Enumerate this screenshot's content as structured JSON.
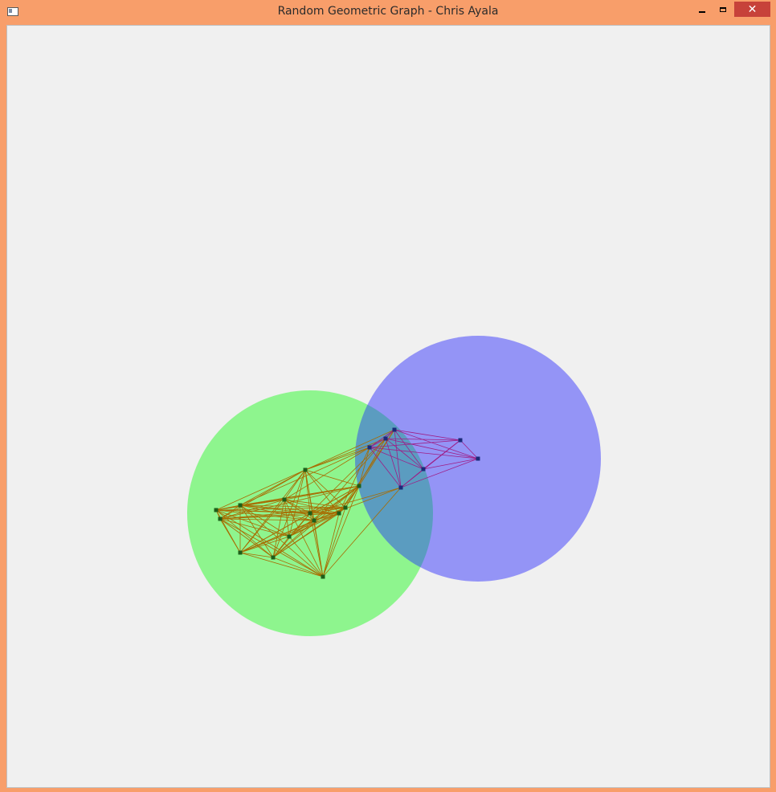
{
  "window": {
    "title": "Random Geometric Graph - Chris Ayala",
    "icons": {
      "app": "app-window-icon",
      "minimize": "minimize-icon",
      "maximize": "maximize-icon",
      "close": "close-icon"
    },
    "close_glyph": "✕"
  },
  "colors": {
    "frame": "#f89e6a",
    "canvas": "#f0f0f0",
    "green_region": "#8ef58e",
    "blue_region": "#9494f6",
    "overlap_region": "#5b9cc0",
    "green_edges": "#a86b00",
    "purple_edges": "#9e1d86",
    "green_nodes": "#1d5f1a",
    "blue_nodes": "#1a2a7a"
  }
}
